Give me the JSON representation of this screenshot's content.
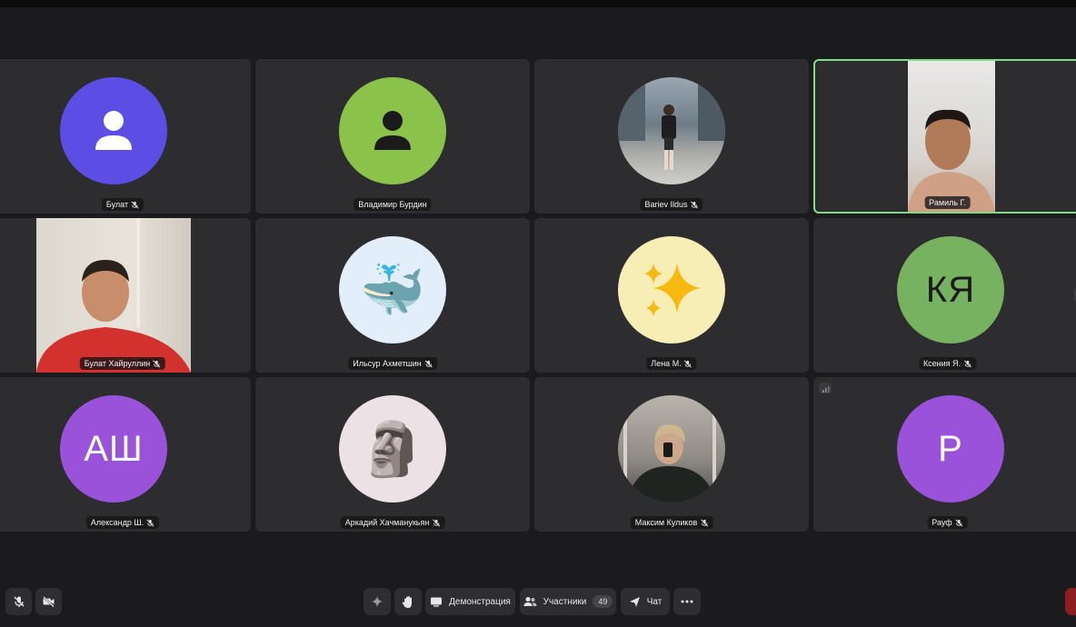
{
  "colors": {
    "background": "#1b1b1d",
    "tile": "#2d2d30",
    "active_border": "#7fdc86",
    "toolbar_button": "#2e2e31",
    "leave_button": "#8e1d21"
  },
  "participants": [
    {
      "name": "Булат",
      "avatar": "person-icon",
      "avatar_color": "#5c4ee5"
    },
    {
      "name": "Владимир Бурдин",
      "avatar": "person-icon",
      "avatar_color": "#8bc34a"
    },
    {
      "name": "Bariev Ildus",
      "avatar": "photo"
    },
    {
      "name": "Рамиль Г.",
      "avatar": "video",
      "speaking": true
    },
    {
      "name": "Булат Хайруллин",
      "avatar": "video"
    },
    {
      "name": "Ильсур Ахметшин",
      "avatar": "whale-emoji",
      "avatar_color": "#e2effa",
      "emoji": "🐳"
    },
    {
      "name": "Лена М.",
      "avatar": "sparkles-emoji",
      "avatar_color": "#f6eeb4",
      "emoji": "✨"
    },
    {
      "name": "Ксения Я.",
      "avatar": "initials",
      "initials": "КЯ",
      "avatar_color": "#76b25f"
    },
    {
      "name": "Александр Ш.",
      "avatar": "initials",
      "initials": "АШ",
      "avatar_color": "#9b52db"
    },
    {
      "name": "Аркадий Хачманукьян",
      "avatar": "moai-emoji",
      "avatar_color": "#ece2e5",
      "emoji": "🗿"
    },
    {
      "name": "Максим Куликов",
      "avatar": "photo"
    },
    {
      "name": "Рауф",
      "avatar": "initials",
      "initials": "Р",
      "avatar_color": "#9b52db"
    }
  ],
  "toolbar": {
    "screen_share_label": "Демонстрация",
    "participants_label": "Участники",
    "participants_count": "49",
    "chat_label": "Чат"
  }
}
